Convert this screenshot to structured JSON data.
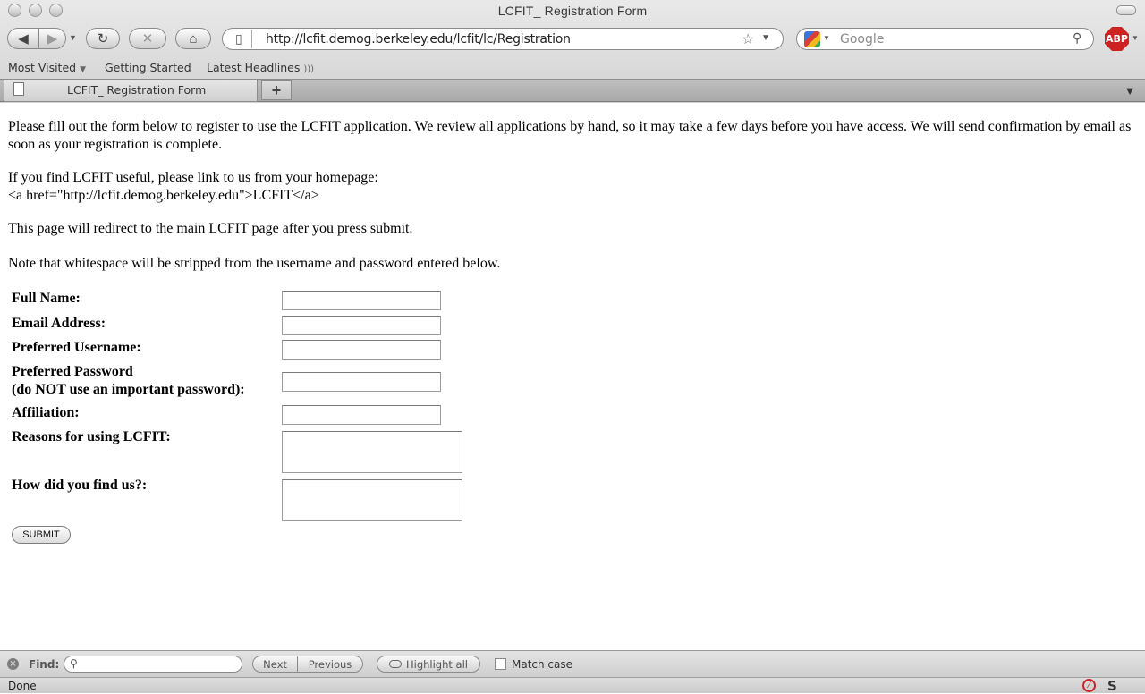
{
  "window": {
    "title": "LCFIT_ Registration Form"
  },
  "navbar": {
    "url": "http://lcfit.demog.berkeley.edu/lcfit/lc/Registration",
    "search_placeholder": "Google",
    "adblock_label": "ABP",
    "icons": [
      "back-icon",
      "forward-icon",
      "history-dropdown-icon",
      "reload-icon",
      "stop-icon",
      "home-icon",
      "page-icon",
      "bookmark-star-icon",
      "url-dropdown-icon",
      "google-icon",
      "search-icon"
    ]
  },
  "bookmarks": {
    "items": [
      "Most Visited",
      "Getting Started",
      "Latest Headlines"
    ]
  },
  "tabs": {
    "active_label": "LCFIT_ Registration Form",
    "new_tab": "+"
  },
  "page": {
    "intro": "Please fill out the form below to register to use the LCFIT application. We review all applications by hand, so it may take a few days before you have access. We will send confirmation by email as soon as your registration is complete.",
    "link_line1": "If you find LCFIT useful, please link to us from your homepage:",
    "link_line2": "<a href=\"http://lcfit.demog.berkeley.edu\">LCFIT</a>",
    "redirect_note": "This page will redirect to the main LCFIT page after you press submit.",
    "whitespace_note": "Note that whitespace will be stripped from the username and password entered below."
  },
  "form": {
    "full_name_label": "Full Name:",
    "email_label": "Email Address:",
    "username_label": "Preferred Username:",
    "password_label_line1": "Preferred Password",
    "password_label_line2": "(do NOT use an important password):",
    "affiliation_label": "Affiliation:",
    "reasons_label": "Reasons for using LCFIT:",
    "found_label": "How did you find us?:",
    "full_name_value": "",
    "email_value": "",
    "username_value": "",
    "password_value": "",
    "affiliation_value": "",
    "submit_label": "SUBMIT"
  },
  "findbar": {
    "label": "Find:",
    "value": "",
    "next": "Next",
    "previous": "Previous",
    "highlight": "Highlight all",
    "match_case": "Match case"
  },
  "status": {
    "text": "Done"
  }
}
